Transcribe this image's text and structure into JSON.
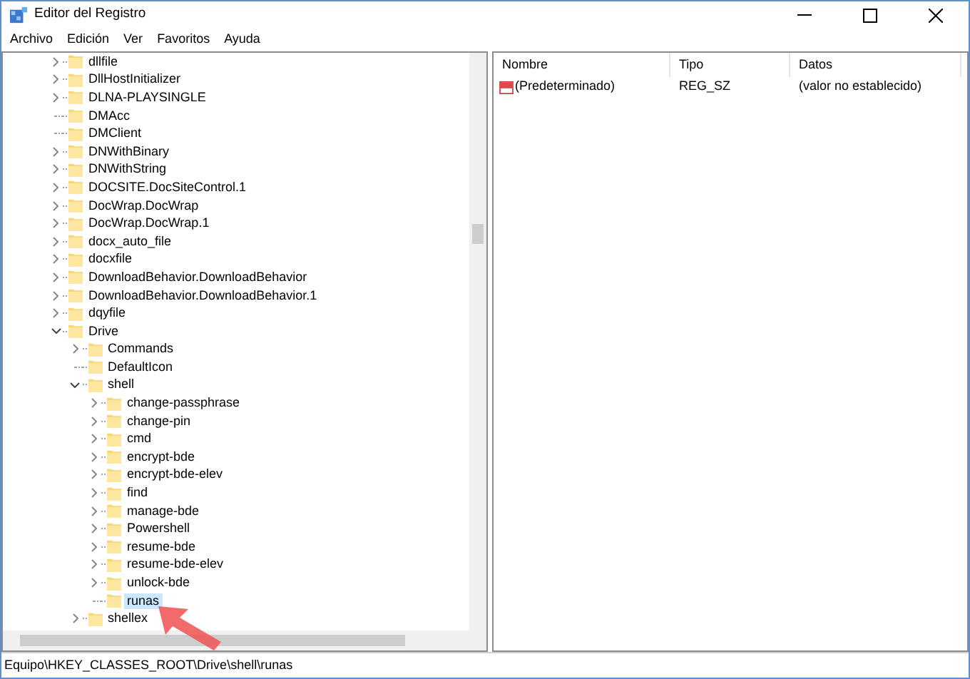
{
  "window": {
    "title": "Editor del Registro"
  },
  "menu": [
    "Archivo",
    "Edición",
    "Ver",
    "Favoritos",
    "Ayuda"
  ],
  "tree": [
    {
      "label": "dllfile",
      "kind": "collapsed",
      "selected": false
    },
    {
      "label": "DllHostInitializer",
      "kind": "collapsed",
      "selected": false
    },
    {
      "label": "DLNA-PLAYSINGLE",
      "kind": "collapsed",
      "selected": false
    },
    {
      "label": "DMAcc",
      "kind": "leaf",
      "selected": false
    },
    {
      "label": "DMClient",
      "kind": "leaf",
      "selected": false
    },
    {
      "label": "DNWithBinary",
      "kind": "collapsed",
      "selected": false
    },
    {
      "label": "DNWithString",
      "kind": "collapsed",
      "selected": false
    },
    {
      "label": "DOCSITE.DocSiteControl.1",
      "kind": "collapsed",
      "selected": false
    },
    {
      "label": "DocWrap.DocWrap",
      "kind": "collapsed",
      "selected": false
    },
    {
      "label": "DocWrap.DocWrap.1",
      "kind": "collapsed",
      "selected": false
    },
    {
      "label": "docx_auto_file",
      "kind": "collapsed",
      "selected": false
    },
    {
      "label": "docxfile",
      "kind": "collapsed",
      "selected": false
    },
    {
      "label": "DownloadBehavior.DownloadBehavior",
      "kind": "collapsed",
      "selected": false
    },
    {
      "label": "DownloadBehavior.DownloadBehavior.1",
      "kind": "collapsed",
      "selected": false
    },
    {
      "label": "dqyfile",
      "kind": "collapsed",
      "selected": false
    },
    {
      "label": "Drive",
      "kind": "expanded",
      "selected": false,
      "children": [
        {
          "label": "Commands",
          "kind": "collapsed",
          "selected": false
        },
        {
          "label": "DefaultIcon",
          "kind": "leaf",
          "selected": false
        },
        {
          "label": "shell",
          "kind": "expanded",
          "selected": false,
          "children": [
            {
              "label": "change-passphrase",
              "kind": "collapsed",
              "selected": false
            },
            {
              "label": "change-pin",
              "kind": "collapsed",
              "selected": false
            },
            {
              "label": "cmd",
              "kind": "collapsed",
              "selected": false
            },
            {
              "label": "encrypt-bde",
              "kind": "collapsed",
              "selected": false
            },
            {
              "label": "encrypt-bde-elev",
              "kind": "collapsed",
              "selected": false
            },
            {
              "label": "find",
              "kind": "collapsed",
              "selected": false
            },
            {
              "label": "manage-bde",
              "kind": "collapsed",
              "selected": false
            },
            {
              "label": "Powershell",
              "kind": "collapsed",
              "selected": false
            },
            {
              "label": "resume-bde",
              "kind": "collapsed",
              "selected": false
            },
            {
              "label": "resume-bde-elev",
              "kind": "collapsed",
              "selected": false
            },
            {
              "label": "unlock-bde",
              "kind": "collapsed",
              "selected": false
            },
            {
              "label": "runas",
              "kind": "leaf",
              "selected": true
            }
          ]
        },
        {
          "label": "shellex",
          "kind": "collapsed",
          "selected": false
        }
      ]
    }
  ],
  "columns": [
    "Nombre",
    "Tipo",
    "Datos"
  ],
  "values": [
    {
      "name": "(Predeterminado)",
      "type": "REG_SZ",
      "data": "(valor no establecido)"
    }
  ],
  "status_bar": "Equipo\\HKEY_CLASSES_ROOT\\Drive\\shell\\runas"
}
